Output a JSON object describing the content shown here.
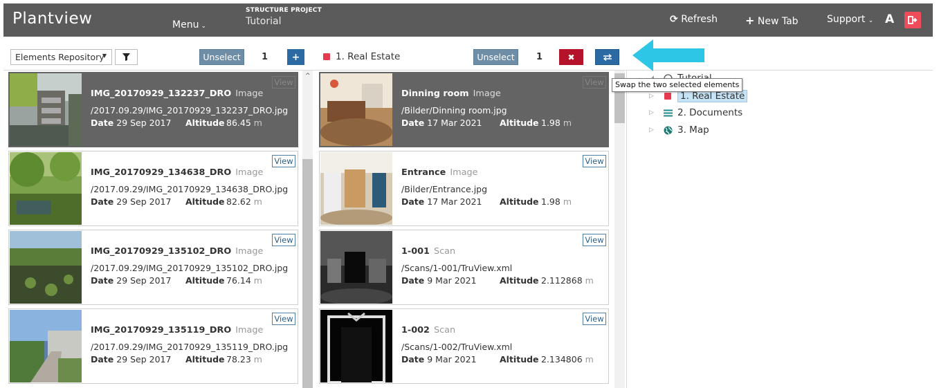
{
  "navbar": {
    "brand": "Plantview",
    "menu_label": "Menu",
    "project_label": "STRUCTURE PROJECT",
    "project_name": "Tutorial",
    "refresh_label": "Refresh",
    "new_tab_label": "New Tab",
    "support_label": "Support",
    "font_label": "A"
  },
  "left_toolbar": {
    "repository_select": "Elements Repository",
    "unselect_label": "Unselect",
    "selected_count": "1"
  },
  "mid_toolbar": {
    "current_folder": "1. Real Estate",
    "unselect_label": "Unselect",
    "selected_count": "1"
  },
  "tooltip": "Swap the two selected elements",
  "labels": {
    "view": "View",
    "date": "Date",
    "altitude": "Altitude",
    "unit": "m"
  },
  "left_items": [
    {
      "name": "IMG_20170929_132237_DRO",
      "type": "Image",
      "path": "/2017.09.29/IMG_20170929_132237_DRO.jpg",
      "date": "29 Sep 2017",
      "altitude": "86.45",
      "selected": true
    },
    {
      "name": "IMG_20170929_134638_DRO",
      "type": "Image",
      "path": "/2017.09.29/IMG_20170929_134638_DRO.jpg",
      "date": "29 Sep 2017",
      "altitude": "82.62",
      "selected": false
    },
    {
      "name": "IMG_20170929_135102_DRO",
      "type": "Image",
      "path": "/2017.09.29/IMG_20170929_135102_DRO.jpg",
      "date": "29 Sep 2017",
      "altitude": "76.14",
      "selected": false
    },
    {
      "name": "IMG_20170929_135119_DRO",
      "type": "Image",
      "path": "/2017.09.29/IMG_20170929_135119_DRO.jpg",
      "date": "29 Sep 2017",
      "altitude": "78.23",
      "selected": false
    }
  ],
  "mid_items": [
    {
      "name": "Dinning room",
      "type": "Image",
      "path": "/Bilder/Dinning room.jpg",
      "date": "17 Mar 2021",
      "altitude": "1.98",
      "selected": true
    },
    {
      "name": "Entrance",
      "type": "Image",
      "path": "/Bilder/Entrance.jpg",
      "date": "17 Mar 2021",
      "altitude": "1.98",
      "selected": false
    },
    {
      "name": "1-001",
      "type": "Scan",
      "path": "/Scans/1-001/TruView.xml",
      "date": "9 Mar 2021",
      "altitude": "2.112868",
      "selected": false
    },
    {
      "name": "1-002",
      "type": "Scan",
      "path": "/Scans/1-002/TruView.xml",
      "date": "9 Mar 2021",
      "altitude": "2.134806",
      "selected": false
    }
  ],
  "tree": {
    "root": "Tutorial",
    "items": [
      {
        "label": "1. Real Estate",
        "icon": "red-square-icon"
      },
      {
        "label": "2. Documents",
        "icon": "list-icon"
      },
      {
        "label": "3. Map",
        "icon": "globe-icon"
      }
    ]
  },
  "colors": {
    "navbar": "#5b5b5b",
    "selected_card": "#646464",
    "primary_blue": "#2c6aa3",
    "danger_red": "#b5122b",
    "arrow_cyan": "#2ec6e6",
    "logout_red": "#ef4b5a"
  }
}
